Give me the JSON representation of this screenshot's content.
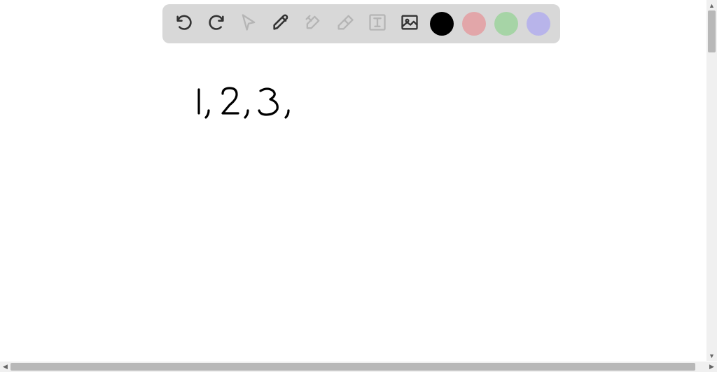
{
  "toolbar": {
    "tools": [
      {
        "name": "undo",
        "enabled": true
      },
      {
        "name": "redo",
        "enabled": true
      },
      {
        "name": "pointer",
        "enabled": false
      },
      {
        "name": "pencil",
        "enabled": true
      },
      {
        "name": "shapes",
        "enabled": false
      },
      {
        "name": "eraser",
        "enabled": false
      },
      {
        "name": "text",
        "enabled": false
      },
      {
        "name": "image",
        "enabled": true
      }
    ],
    "colors": [
      {
        "name": "black",
        "hex": "#000000",
        "selected": true
      },
      {
        "name": "pink",
        "hex": "#e2a6a9",
        "selected": false
      },
      {
        "name": "green",
        "hex": "#a6d4a6",
        "selected": false
      },
      {
        "name": "purple",
        "hex": "#b8b4ea",
        "selected": false
      }
    ]
  },
  "canvas": {
    "handwritten_text": "1, 2, 3,"
  }
}
